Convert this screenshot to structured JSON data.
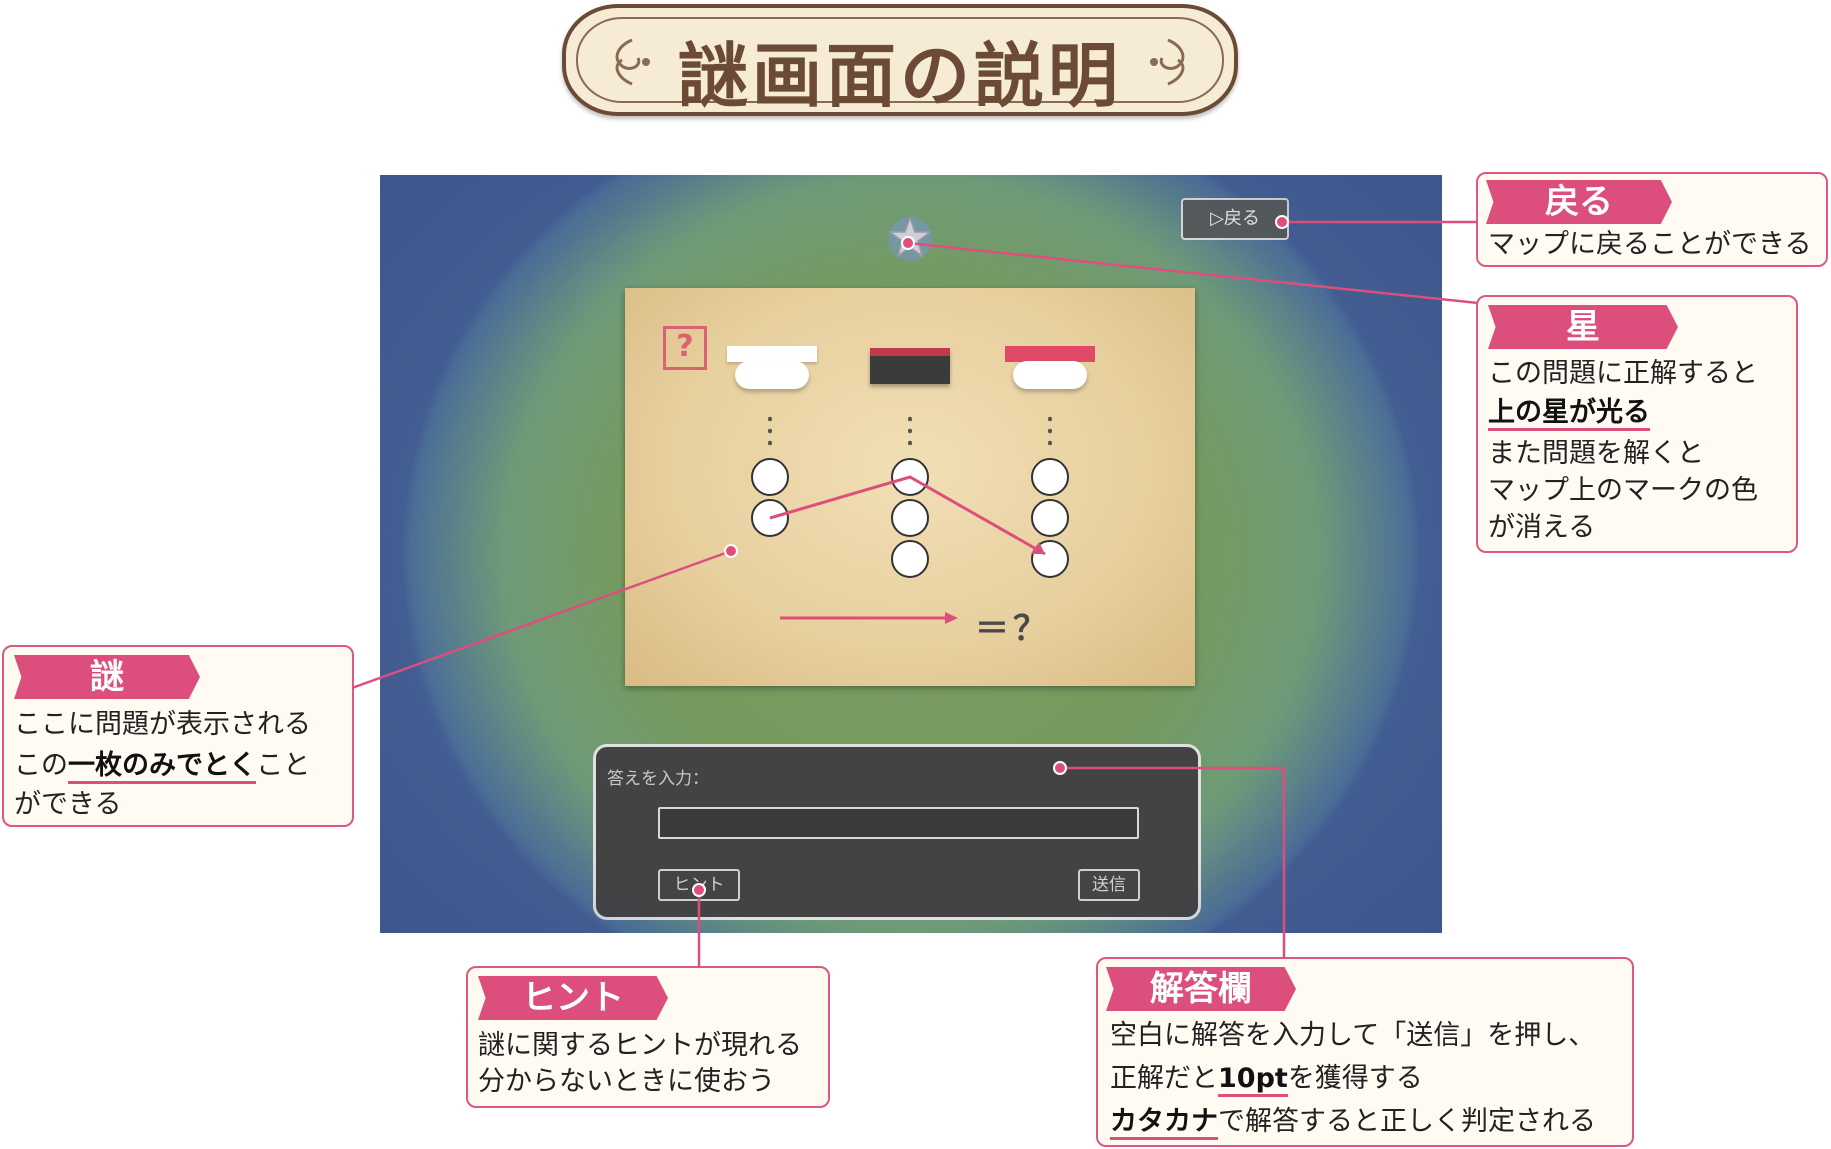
{
  "header": {
    "title": "謎画面の説明"
  },
  "game": {
    "back_button": "▷戻る",
    "puzzle": {
      "mark": "?",
      "equation": "＝？"
    },
    "answer_panel": {
      "label": "答えを入力：",
      "hint_button": "ヒント",
      "submit_button": "送信"
    }
  },
  "callouts": {
    "back": {
      "tag": "戻る",
      "lines": [
        "マップに戻ることができる"
      ]
    },
    "star": {
      "tag": "星",
      "line1": "この問題に正解すると",
      "line2_em": "上の星が光る",
      "line3": "また問題を解くと",
      "line4": "マップ上のマークの色",
      "line5": "が消える"
    },
    "puzzle": {
      "tag": "謎",
      "line1": "ここに問題が表示される",
      "line2_pre": "この",
      "line2_em": "一枚のみでとく",
      "line2_post": "こと",
      "line3": "ができる"
    },
    "hint": {
      "tag": "ヒント",
      "line1": "謎に関するヒントが現れる",
      "line2": "分からないときに使おう"
    },
    "answer": {
      "tag": "解答欄",
      "line1": "空白に解答を入力して「送信」を押し、",
      "line2_pre": "正解だと",
      "line2_em": "10pt",
      "line2_post": "を獲得する",
      "line3_em": "カタカナ",
      "line3_post": "で解答すると正しく判定される"
    }
  },
  "colors": {
    "accent": "#dc4f7d",
    "banner_brown": "#6b4a36",
    "panel_dark": "#434343"
  }
}
